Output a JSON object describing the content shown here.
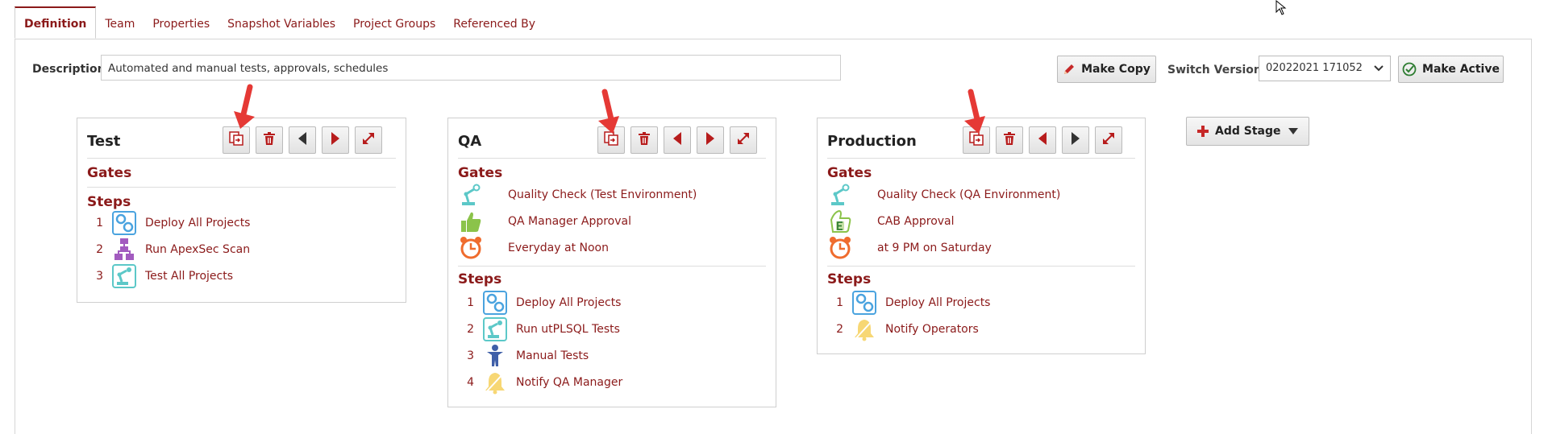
{
  "tabs": [
    "Definition",
    "Team",
    "Properties",
    "Snapshot Variables",
    "Project Groups",
    "Referenced By"
  ],
  "description": {
    "label": "Description",
    "value": "Automated and manual tests, approvals, schedules"
  },
  "toolbar": {
    "make_copy": "Make Copy",
    "switch_version_label": "Switch Version",
    "version_selected": "02022021 171052",
    "make_active": "Make Active",
    "add_stage": "Add Stage"
  },
  "section_labels": {
    "gates": "Gates",
    "steps": "Steps"
  },
  "stages": [
    {
      "name": "Test",
      "gates": [],
      "steps": [
        {
          "num": "1",
          "label": "Deploy All Projects",
          "icon": "deploy-icon"
        },
        {
          "num": "2",
          "label": "Run ApexSec Scan",
          "icon": "flowchart-icon"
        },
        {
          "num": "3",
          "label": "Test All Projects",
          "icon": "robot-arm-icon"
        }
      ]
    },
    {
      "name": "QA",
      "gates": [
        {
          "label": "Quality Check (Test Environment)",
          "icon": "robot-arm-icon"
        },
        {
          "label": "QA Manager Approval",
          "icon": "thumbs-up-icon"
        },
        {
          "label": "Everyday at Noon",
          "icon": "alarm-clock-icon"
        }
      ],
      "steps": [
        {
          "num": "1",
          "label": "Deploy All Projects",
          "icon": "deploy-icon"
        },
        {
          "num": "2",
          "label": "Run utPLSQL Tests",
          "icon": "robot-arm-icon"
        },
        {
          "num": "3",
          "label": "Manual Tests",
          "icon": "person-icon"
        },
        {
          "num": "4",
          "label": "Notify QA Manager",
          "icon": "bell-icon"
        }
      ]
    },
    {
      "name": "Production",
      "gates": [
        {
          "label": "Quality Check (QA Environment)",
          "icon": "robot-arm-icon"
        },
        {
          "label": "CAB Approval",
          "icon": "thumbs-up-e-icon"
        },
        {
          "label": "at 9 PM on Saturday",
          "icon": "alarm-clock-icon"
        }
      ],
      "steps": [
        {
          "num": "1",
          "label": "Deploy All Projects",
          "icon": "deploy-icon"
        },
        {
          "num": "2",
          "label": "Notify Operators",
          "icon": "bell-icon"
        }
      ]
    }
  ],
  "colors": {
    "accent": "#8b1a1a",
    "annotation_arrow": "#e53935"
  }
}
